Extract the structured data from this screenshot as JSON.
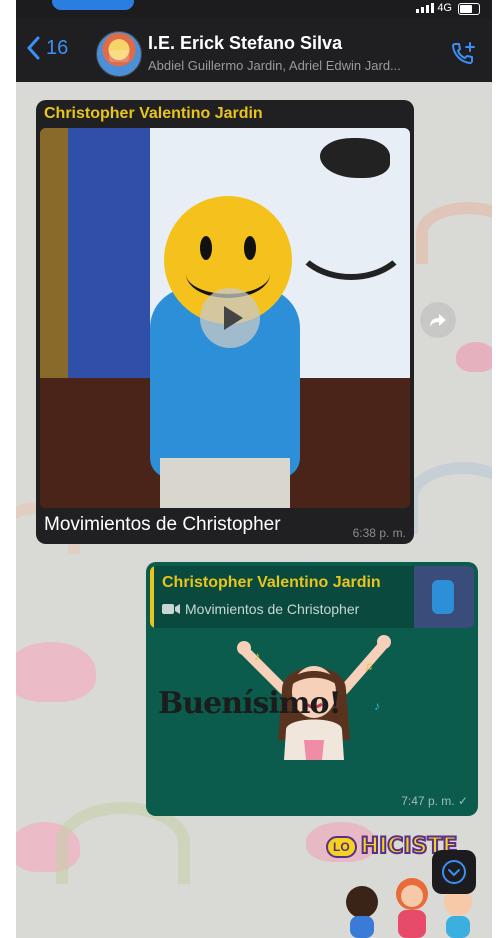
{
  "header": {
    "back_count": "16",
    "title": "I.E. Erick Stefano Silva",
    "subtitle": "Abdiel Guillermo Jardin, Adriel Edwin Jard..."
  },
  "status": {
    "network": "4G"
  },
  "messages": [
    {
      "sender": "Christopher Valentino Jardin",
      "caption": "Movimientos de Christopher",
      "time": "6:38 p. m."
    },
    {
      "quote_sender": "Christopher Valentino Jardin",
      "quote_text": "Movimientos de Christopher",
      "sticker_text": "Buenísimo!",
      "time": "7:47 p. m. ✓"
    }
  ],
  "sticker2": {
    "lo": "LO",
    "text": "HICISTE"
  },
  "colors": {
    "accent": "#3b8ff5",
    "sender": "#e8c41c",
    "outgoing": "#0b5c4c",
    "incoming": "#202022"
  }
}
